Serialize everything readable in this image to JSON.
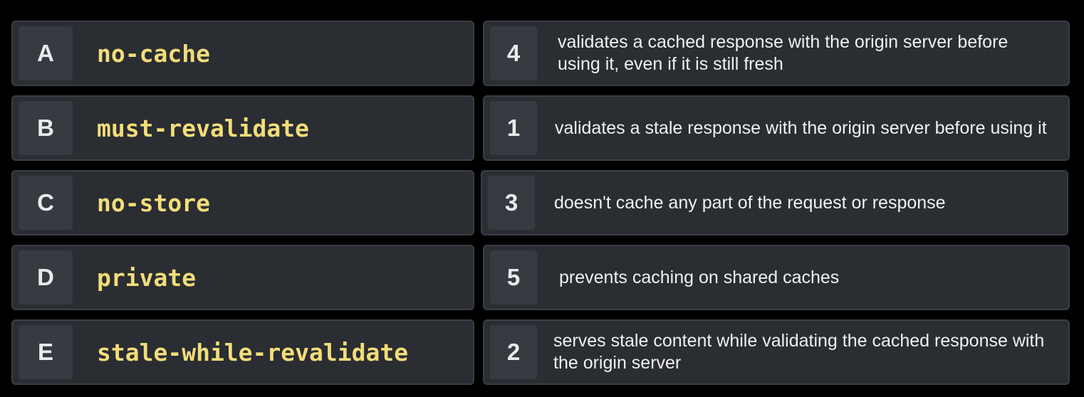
{
  "terms": [
    {
      "letter": "A",
      "term": "no-cache"
    },
    {
      "letter": "B",
      "term": "must-revalidate"
    },
    {
      "letter": "C",
      "term": "no-store"
    },
    {
      "letter": "D",
      "term": "private"
    },
    {
      "letter": "E",
      "term": "stale-while-revalidate"
    }
  ],
  "definitions": [
    {
      "number": "4",
      "text": "validates a cached response with the origin server before using it, even if it is still fresh"
    },
    {
      "number": "1",
      "text": "validates a stale response with the origin server before using it"
    },
    {
      "number": "3",
      "text": "doesn't cache any part of the request or response"
    },
    {
      "number": "5",
      "text": "prevents caching on shared caches"
    },
    {
      "number": "2",
      "text": "serves stale content while validating the cached response with the origin server"
    }
  ]
}
